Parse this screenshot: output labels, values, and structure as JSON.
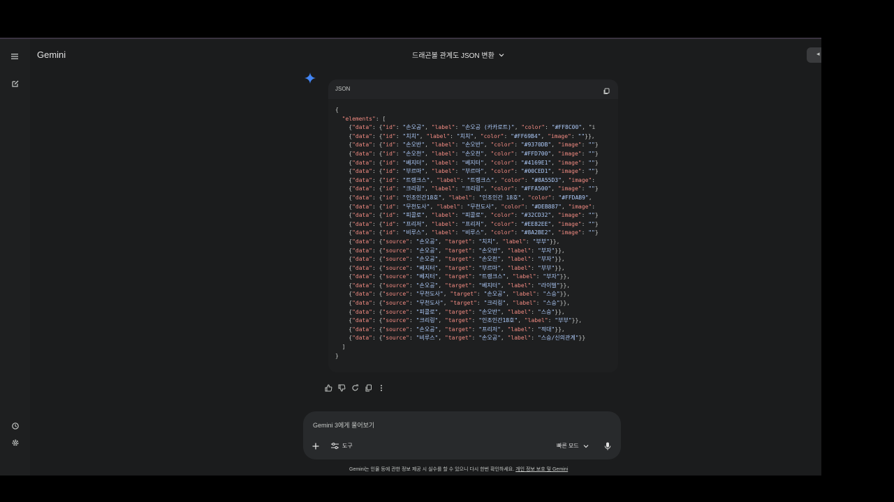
{
  "app": {
    "title": "Gemini"
  },
  "conversation": {
    "title": "드래곤볼 관계도 JSON 변환"
  },
  "header": {
    "share_icon": "share-icon"
  },
  "code_block": {
    "language": "JSON",
    "lines": [
      "{",
      "  \"elements\": [",
      "    {\"data\": {\"id\": \"손오공\", \"label\": \"손오공 (카카로트)\", \"color\": \"#FF8C00\", \"i",
      "    {\"data\": {\"id\": \"치치\", \"label\": \"치치\", \"color\": \"#FF69B4\", \"image\": \"\"}},",
      "    {\"data\": {\"id\": \"손오반\", \"label\": \"손오반\", \"color\": \"#9370DB\", \"image\": \"\"}",
      "    {\"data\": {\"id\": \"손오천\", \"label\": \"손오천\", \"color\": \"#FFD700\", \"image\": \"\"}",
      "    {\"data\": {\"id\": \"베지터\", \"label\": \"베지터\", \"color\": \"#4169E1\", \"image\": \"\"}",
      "    {\"data\": {\"id\": \"부르마\", \"label\": \"부르마\", \"color\": \"#00CED1\", \"image\": \"\"}",
      "    {\"data\": {\"id\": \"트랭크스\", \"label\": \"트랭크스\", \"color\": \"#8A55D3\", \"image\":",
      "    {\"data\": {\"id\": \"크리링\", \"label\": \"크리링\", \"color\": \"#FFA500\", \"image\": \"\"}",
      "    {\"data\": {\"id\": \"인조인간18호\", \"label\": \"인조인간 18호\", \"color\": \"#FFDAB9\",",
      "    {\"data\": {\"id\": \"무천도사\", \"label\": \"무천도사\", \"color\": \"#DEB887\", \"image\":",
      "    {\"data\": {\"id\": \"피콜로\", \"label\": \"피콜로\", \"color\": \"#32CD32\", \"image\": \"\"}",
      "    {\"data\": {\"id\": \"프리저\", \"label\": \"프리저\", \"color\": \"#EE82EE\", \"image\": \"\"}",
      "    {\"data\": {\"id\": \"비루스\", \"label\": \"비루스\", \"color\": \"#8A2BE2\", \"image\": \"\"}",
      "    {\"data\": {\"source\": \"손오공\", \"target\": \"치치\", \"label\": \"부부\"}},",
      "    {\"data\": {\"source\": \"손오공\", \"target\": \"손오반\", \"label\": \"부자\"}},",
      "    {\"data\": {\"source\": \"손오공\", \"target\": \"손오천\", \"label\": \"부자\"}},",
      "    {\"data\": {\"source\": \"베지터\", \"target\": \"부르마\", \"label\": \"부부\"}},",
      "    {\"data\": {\"source\": \"베지터\", \"target\": \"트랭크스\", \"label\": \"부자\"}},",
      "    {\"data\": {\"source\": \"손오공\", \"target\": \"베지터\", \"label\": \"라이벌\"}},",
      "    {\"data\": {\"source\": \"무천도사\", \"target\": \"손오공\", \"label\": \"스승\"}},",
      "    {\"data\": {\"source\": \"무천도사\", \"target\": \"크리링\", \"label\": \"스승\"}},",
      "    {\"data\": {\"source\": \"피콜로\", \"target\": \"손오반\", \"label\": \"스승\"}},",
      "    {\"data\": {\"source\": \"크리링\", \"target\": \"인조인간18호\", \"label\": \"부부\"}},",
      "    {\"data\": {\"source\": \"손오공\", \"target\": \"프리저\", \"label\": \"적대\"}},",
      "    {\"data\": {\"source\": \"비루스\", \"target\": \"손오공\", \"label\": \"스승/신의관계\"}}",
      "  ]",
      "}"
    ]
  },
  "composer": {
    "placeholder": "Gemini 3에게 물어보기",
    "tools_label": "도구",
    "mode_label": "빠른 모드"
  },
  "footer": {
    "disclaimer": "Gemini는 인물 등에 관한 정보 제공 시 실수를 할 수 있으니 다시 한번 확인하세요.",
    "link": "개인 정보 보호 및 Gemini"
  },
  "colors": {
    "background": "#1b1c1d",
    "sidebar": "#1e1f20",
    "code_key": "#f28b82",
    "code_string": "#aecbfa",
    "gemini_star": "#4285f4"
  }
}
